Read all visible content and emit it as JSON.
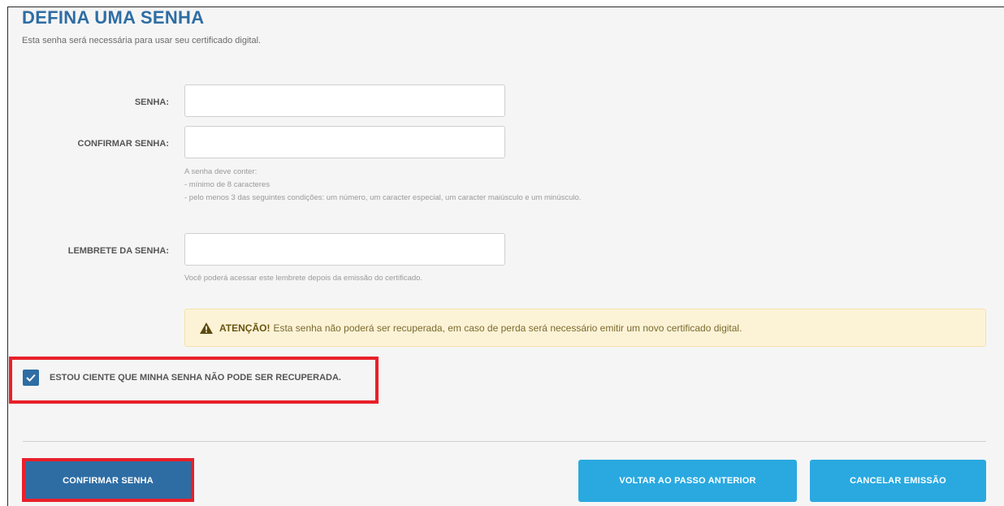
{
  "header": {
    "title": "DEFINA UMA SENHA",
    "subtitle": "Esta senha será necessária para usar seu certificado digital."
  },
  "form": {
    "password": {
      "label": "SENHA:",
      "value": "",
      "placeholder": ""
    },
    "confirm_password": {
      "label": "CONFIRMAR SENHA:",
      "value": "",
      "placeholder": ""
    },
    "rules": {
      "intro": "A senha deve conter:",
      "rule1": "- mínimo de 8 caracteres",
      "rule2": "- pelo menos 3 das seguintes condições: um número, um caracter especial, um caracter maiúsculo e um minúsculo."
    },
    "reminder": {
      "label": "LEMBRETE DA SENHA:",
      "value": "",
      "placeholder": "",
      "hint": "Você poderá acessar este lembrete depois da emissão do certificado."
    }
  },
  "alert": {
    "icon": "warning-icon",
    "strong": "ATENÇÃO!",
    "text": "Esta senha não poderá ser recuperada, em caso de perda será necessário emitir um novo certificado digital."
  },
  "acknowledge": {
    "checked": true,
    "label": "ESTOU CIENTE QUE MINHA SENHA NÃO PODE SER RECUPERADA."
  },
  "buttons": {
    "confirm": "CONFIRMAR SENHA",
    "back": "VOLTAR AO PASSO ANTERIOR",
    "cancel": "CANCELAR EMISSÃO"
  },
  "colors": {
    "title_blue": "#2e6da4",
    "primary_button": "#2e6da4",
    "secondary_button": "#29a9e0",
    "highlight_red": "#e8202a",
    "alert_background": "#fcf3d7"
  }
}
